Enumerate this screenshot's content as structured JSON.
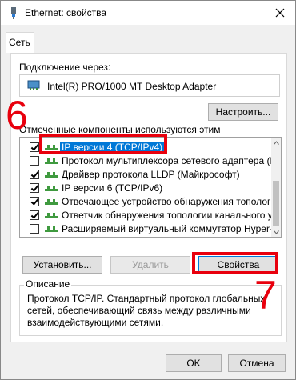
{
  "window": {
    "title": "Ethernet: свойства",
    "tab": "Сеть"
  },
  "connection": {
    "label": "Подключение через:",
    "adapter": "Intel(R) PRO/1000 MT Desktop Adapter",
    "configure_button": "Настроить..."
  },
  "components": {
    "label": "Отмеченные компоненты используются этим подключением:",
    "items": [
      {
        "label": "IP версии 4 (TCP/IPv4)",
        "checked": true,
        "selected": true
      },
      {
        "label": "Протокол мультиплексора сетевого адаптера (Май",
        "checked": false,
        "selected": false
      },
      {
        "label": "Драйвер протокола LLDP (Майкрософт)",
        "checked": true,
        "selected": false
      },
      {
        "label": "IP версии 6 (TCP/IPv6)",
        "checked": true,
        "selected": false
      },
      {
        "label": "Отвечающее устройство обнаружения топологии к",
        "checked": true,
        "selected": false
      },
      {
        "label": "Ответчик обнаружения топологии канального уров",
        "checked": true,
        "selected": false
      },
      {
        "label": "Расширяемый виртуальный коммутатор Hyper-V",
        "checked": false,
        "selected": false
      }
    ]
  },
  "actions": {
    "install": "Установить...",
    "remove": "Удалить",
    "properties": "Свойства"
  },
  "description": {
    "legend": "Описание",
    "text": "Протокол TCP/IP. Стандартный протокол глобальных сетей, обеспечивающий связь между различными взаимодействующими сетями."
  },
  "footer": {
    "ok": "OK",
    "cancel": "Отмена"
  },
  "annotations": {
    "step6": "6",
    "step7": "7",
    "color": "#e8000d"
  },
  "colors": {
    "selection": "#0078d7",
    "focus_border": "#0078d7"
  }
}
